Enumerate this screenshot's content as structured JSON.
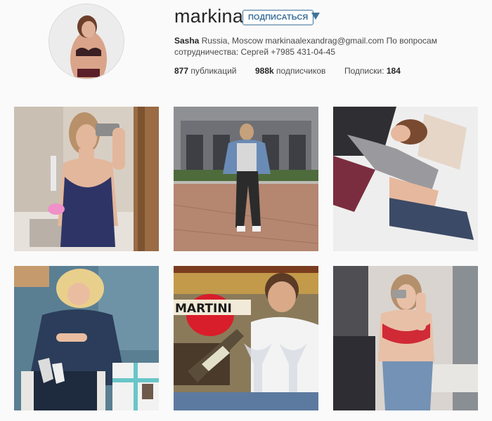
{
  "profile": {
    "username": "markina",
    "follow_button": "ПОДПИСАТЬСЯ",
    "bio_name": "Sasha",
    "bio_text": " Russia, Moscow markinaalexandrag@gmail.com По вопросам сотрудничества: Сергей +7985 431-04-45",
    "stats": {
      "posts_value": "877",
      "posts_label": " публикаций",
      "followers_value": "988k",
      "followers_label": " подписчиков",
      "following_label": "Подписки: ",
      "following_value": "184"
    }
  },
  "colors": {
    "accent": "#3f729b",
    "background": "#fafafa"
  },
  "posts": [
    {
      "id": 1,
      "signage": ""
    },
    {
      "id": 2,
      "signage": ""
    },
    {
      "id": 3,
      "signage": ""
    },
    {
      "id": 4,
      "signage": ""
    },
    {
      "id": 5,
      "signage": "MARTINI"
    },
    {
      "id": 6,
      "signage": ""
    }
  ]
}
